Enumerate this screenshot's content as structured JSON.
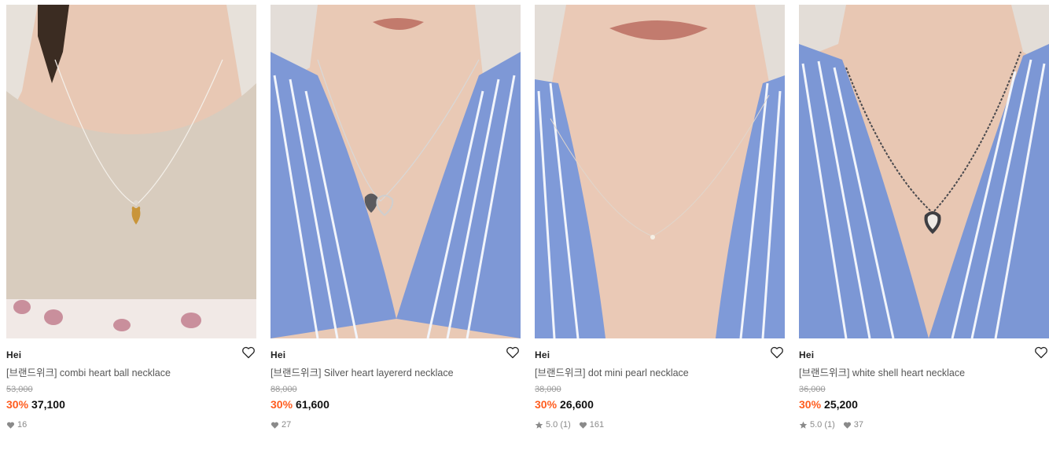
{
  "products": [
    {
      "brand": "Hei",
      "name": "[브랜드위크] combi heart ball necklace",
      "original_price": "53,000",
      "discount": "30%",
      "price": "37,100",
      "rating": "",
      "likes": "16",
      "image": {
        "background": "#e7e1da",
        "top": "#ded8d2",
        "skin": "#e8c8b4",
        "garment": "#d8ccbe",
        "garment_stripe": "#ffffff",
        "pendant": "#c9953a"
      }
    },
    {
      "brand": "Hei",
      "name": "[브랜드위크] Silver heart layererd necklace",
      "original_price": "88,000",
      "discount": "30%",
      "price": "61,600",
      "rating": "",
      "likes": "27",
      "image": {
        "background": "#e7e3de",
        "top": "#e3ddd8",
        "skin": "#e9c9b5",
        "garment": "#7e98d6",
        "garment_stripe": "#f2f5fb",
        "pendant": "#5a5a5e"
      }
    },
    {
      "brand": "Hei",
      "name": "[브랜드위크] dot mini pearl necklace",
      "original_price": "38,000",
      "discount": "30%",
      "price": "26,600",
      "rating": "5.0 (1)",
      "likes": "161",
      "image": {
        "background": "#e6e1dc",
        "top": "#e3ddd7",
        "skin": "#eac9b6",
        "garment": "#7f9ad8",
        "garment_stripe": "#f2f5fb",
        "pendant": "#f5f0e6"
      }
    },
    {
      "brand": "Hei",
      "name": "[브랜드위크] white shell heart necklace",
      "original_price": "36,000",
      "discount": "30%",
      "price": "25,200",
      "rating": "5.0 (1)",
      "likes": "37",
      "image": {
        "background": "#e6e1dc",
        "top": "#e3ddd7",
        "skin": "#e8c7b3",
        "garment": "#7c97d5",
        "garment_stripe": "#f2f5fb",
        "pendant": "#3e3e42"
      }
    }
  ],
  "icons": {
    "wishlist": "heart-outline-icon",
    "likes": "heart-filled-icon",
    "rating": "star-icon"
  },
  "colors": {
    "discount": "#ff5d1f",
    "original_price": "#9a9a9a",
    "meta": "#8a8a8a"
  }
}
